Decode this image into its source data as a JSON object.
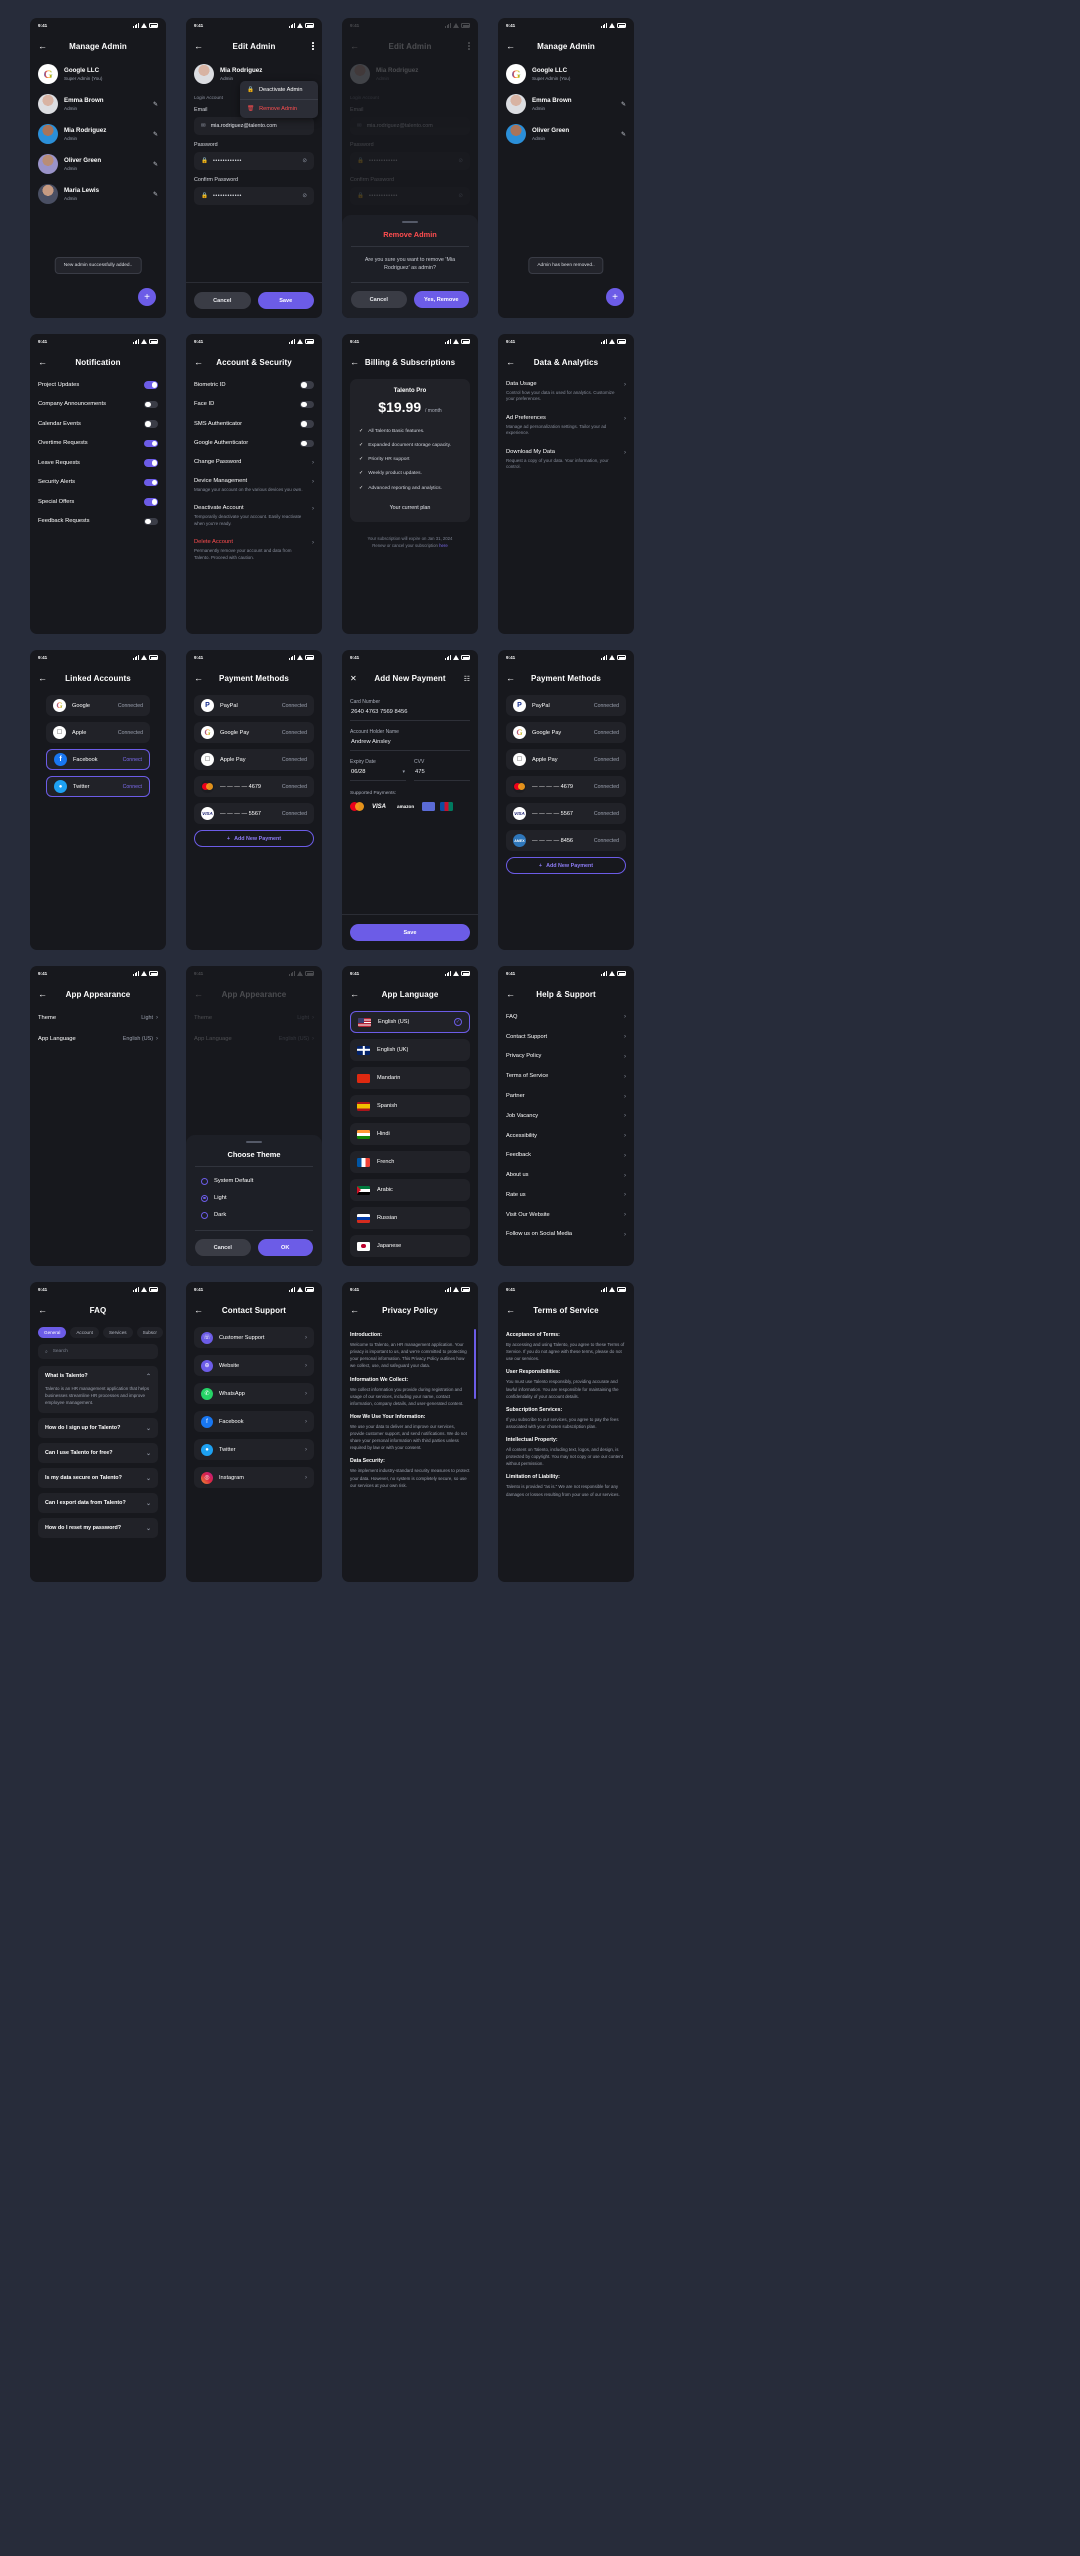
{
  "status_bar": {
    "time": "9:41"
  },
  "screens": {
    "manage_admin": {
      "title": "Manage Admin",
      "toast": "New admin successfully added..",
      "fab": "+",
      "admins": [
        {
          "name": "Google LLC",
          "role": "Super Admin (You)",
          "editable": false
        },
        {
          "name": "Emma Brown",
          "role": "Admin",
          "editable": true
        },
        {
          "name": "Mia Rodriguez",
          "role": "Admin",
          "editable": true
        },
        {
          "name": "Oliver Green",
          "role": "Admin",
          "editable": true
        },
        {
          "name": "Maria Lewis",
          "role": "Admin",
          "editable": true
        }
      ]
    },
    "manage_admin_after": {
      "title": "Manage Admin",
      "toast": "Admin has been removed..",
      "admins": [
        {
          "name": "Google LLC",
          "role": "Super Admin (You)",
          "editable": false
        },
        {
          "name": "Emma Brown",
          "role": "Admin",
          "editable": true
        },
        {
          "name": "Oliver Green",
          "role": "Admin",
          "editable": true
        }
      ]
    },
    "edit_admin": {
      "title": "Edit Admin",
      "user_name": "Mia Rodriguez",
      "user_role": "Admin",
      "section_label": "Login Account",
      "menu": [
        {
          "label": "Deactivate Admin",
          "icon": "lock-icon",
          "danger": false
        },
        {
          "label": "Remove Admin",
          "icon": "trash-icon",
          "danger": true
        }
      ],
      "email_label": "Email",
      "email_value": "mia.rodriguez@talento.com",
      "password_label": "Password",
      "password_value": "••••••••••••",
      "confirm_label": "Confirm Password",
      "confirm_value": "••••••••••••",
      "cancel": "Cancel",
      "save": "Save"
    },
    "remove_admin_dialog": {
      "title": "Remove Admin",
      "message": "Are you sure you want to remove 'Mia Rodriguez' as admin?",
      "cancel": "Cancel",
      "confirm": "Yes, Remove"
    },
    "notification": {
      "title": "Notification",
      "items": [
        {
          "label": "Project Updates",
          "on": true
        },
        {
          "label": "Company Announcements",
          "on": false
        },
        {
          "label": "Calendar Events",
          "on": false
        },
        {
          "label": "Overtime Requests",
          "on": true
        },
        {
          "label": "Leave Requests",
          "on": true
        },
        {
          "label": "Security Alerts",
          "on": true
        },
        {
          "label": "Special Offers",
          "on": true
        },
        {
          "label": "Feedback Requests",
          "on": false
        }
      ]
    },
    "account_security": {
      "title": "Account & Security",
      "toggles": [
        {
          "label": "Biometric ID",
          "on": false
        },
        {
          "label": "Face ID",
          "on": false
        },
        {
          "label": "SMS Authenticator",
          "on": false
        },
        {
          "label": "Google Authenticator",
          "on": false
        }
      ],
      "links": [
        {
          "title": "Change Password",
          "desc": ""
        },
        {
          "title": "Device Management",
          "desc": "Manage your account on the various devices you own."
        },
        {
          "title": "Deactivate Account",
          "desc": "Temporarily deactivate your account. Easily reactivate when you're ready."
        },
        {
          "title": "Delete Account",
          "desc": "Permanently remove your account and data from Talento. Proceed with caution.",
          "danger": true
        }
      ]
    },
    "billing": {
      "title": "Billing & Subscriptions",
      "plan_name": "Talento Pro",
      "price": "$19.99",
      "period": "/ month",
      "features": [
        "All Talento Basic features.",
        "Expanded document storage capacity.",
        "Priority HR support",
        "Weekly product updates.",
        "Advanced reporting and analytics."
      ],
      "current_plan": "Your current plan",
      "note_a": "Your subscription will expire on Jan 31, 2024",
      "note_b": "Renew or cancel your subscription ",
      "note_link": "here"
    },
    "data_analytics": {
      "title": "Data & Analytics",
      "items": [
        {
          "title": "Data Usage",
          "desc": "Control how your data is used for analytics. Customize your preferences."
        },
        {
          "title": "Ad Preferences",
          "desc": "Manage ad personalization settings. Tailor your ad experience."
        },
        {
          "title": "Download My Data",
          "desc": "Request a copy of your data. Your information, your control."
        }
      ]
    },
    "linked_accounts": {
      "title": "Linked Accounts",
      "items": [
        {
          "name": "Google",
          "state": "Connected",
          "connected": true,
          "brand": "google-icon"
        },
        {
          "name": "Apple",
          "state": "Connected",
          "connected": true,
          "brand": "apple-icon"
        },
        {
          "name": "Facebook",
          "state": "Connect",
          "connected": false,
          "brand": "facebook-icon"
        },
        {
          "name": "Twitter",
          "state": "Connect",
          "connected": false,
          "brand": "twitter-icon"
        }
      ]
    },
    "payment_methods": {
      "title": "Payment Methods",
      "add_label": "Add New Payment",
      "items": [
        {
          "name": "PayPal",
          "state": "Connected",
          "brand": "paypal-icon"
        },
        {
          "name": "Google Pay",
          "state": "Connected",
          "brand": "gpay-icon"
        },
        {
          "name": "Apple Pay",
          "state": "Connected",
          "brand": "applepay-icon"
        },
        {
          "name": "—  —  —  —  4679",
          "state": "Connected",
          "brand": "mastercard-icon"
        },
        {
          "name": "—  —  —  —  5567",
          "state": "Connected",
          "brand": "visa-icon"
        }
      ]
    },
    "payment_methods_after": {
      "title": "Payment Methods",
      "add_label": "Add New Payment",
      "items": [
        {
          "name": "PayPal",
          "state": "Connected",
          "brand": "paypal-icon"
        },
        {
          "name": "Google Pay",
          "state": "Connected",
          "brand": "gpay-icon"
        },
        {
          "name": "Apple Pay",
          "state": "Connected",
          "brand": "applepay-icon"
        },
        {
          "name": "—  —  —  —  4679",
          "state": "Connected",
          "brand": "mastercard-icon"
        },
        {
          "name": "—  —  —  —  5567",
          "state": "Connected",
          "brand": "visa-icon"
        },
        {
          "name": "—  —  —  —  8456",
          "state": "Connected",
          "brand": "amex-icon"
        }
      ]
    },
    "add_payment": {
      "title": "Add New Payment",
      "card_label": "Card Number",
      "card_value": "2640 4763 7569 8456",
      "holder_label": "Account Holder Name",
      "holder_value": "Andrew Ainsley",
      "expiry_label": "Expiry Date",
      "expiry_value": "06/28",
      "cvv_label": "CVV",
      "cvv_value": "475",
      "supported_label": "Supported Payments:",
      "logos": [
        "mastercard",
        "VISA",
        "amazon",
        "stripe",
        "JCB"
      ],
      "save": "Save"
    },
    "app_appearance": {
      "title": "App Appearance",
      "theme_label": "Theme",
      "theme_value": "Light",
      "language_label": "App Language",
      "language_value": "English (US)"
    },
    "choose_theme": {
      "title": "Choose Theme",
      "options": [
        {
          "label": "System Default",
          "selected": false
        },
        {
          "label": "Light",
          "selected": true
        },
        {
          "label": "Dark",
          "selected": false
        }
      ],
      "cancel": "Cancel",
      "ok": "OK"
    },
    "app_language": {
      "title": "App Language",
      "items": [
        {
          "label": "English (US)",
          "flag": "f-us",
          "selected": true
        },
        {
          "label": "English (UK)",
          "flag": "f-uk",
          "selected": false
        },
        {
          "label": "Mandarin",
          "flag": "f-cn",
          "selected": false
        },
        {
          "label": "Spanish",
          "flag": "f-es",
          "selected": false
        },
        {
          "label": "Hindi",
          "flag": "f-in",
          "selected": false
        },
        {
          "label": "French",
          "flag": "f-fr",
          "selected": false
        },
        {
          "label": "Arabic",
          "flag": "f-ar",
          "selected": false
        },
        {
          "label": "Russian",
          "flag": "f-ru",
          "selected": false
        },
        {
          "label": "Japanese",
          "flag": "f-jp",
          "selected": false
        }
      ]
    },
    "help_support": {
      "title": "Help & Support",
      "items": [
        "FAQ",
        "Contact Support",
        "Privacy Policy",
        "Terms of Service",
        "Partner",
        "Job Vacancy",
        "Accessibility",
        "Feedback",
        "About us",
        "Rate us",
        "Visit Our Website",
        "Follow us on Social Media"
      ]
    },
    "faq": {
      "title": "FAQ",
      "chips": [
        "General",
        "Account",
        "Services",
        "Subscr"
      ],
      "search_placeholder": "Search",
      "items": [
        {
          "q": "What is Talento?",
          "a": "Talento is an HR management application that helps businesses streamline HR processes and improve employee management.",
          "open": true
        },
        {
          "q": "How do I sign up for Talento?",
          "a": "",
          "open": false
        },
        {
          "q": "Can I use Talento for free?",
          "a": "",
          "open": false
        },
        {
          "q": "Is my data secure on Talento?",
          "a": "",
          "open": false
        },
        {
          "q": "Can I export data from Talento?",
          "a": "",
          "open": false
        },
        {
          "q": "How do I reset my password?",
          "a": "",
          "open": false
        }
      ]
    },
    "contact_support": {
      "title": "Contact Support",
      "items": [
        {
          "label": "Customer Support",
          "icon": "headset-icon"
        },
        {
          "label": "Website",
          "icon": "globe-icon"
        },
        {
          "label": "WhatsApp",
          "icon": "whatsapp-icon"
        },
        {
          "label": "Facebook",
          "icon": "facebook-icon"
        },
        {
          "label": "Twitter",
          "icon": "twitter-icon"
        },
        {
          "label": "Instagram",
          "icon": "instagram-icon"
        }
      ]
    },
    "privacy_policy": {
      "title": "Privacy Policy",
      "sections": [
        {
          "h": "Introduction:",
          "p": "Welcome to Talento, an HR management application. Your privacy is important to us, and we're committed to protecting your personal information. This Privacy Policy outlines how we collect, use, and safeguard your data."
        },
        {
          "h": "Information We Collect:",
          "p": "We collect information you provide during registration and usage of our services, including your name, contact information, company details, and user-generated content."
        },
        {
          "h": "How We Use Your Information:",
          "p": "We use your data to deliver and improve our services, provide customer support, and send notifications. We do not share your personal information with third parties unless required by law or with your consent."
        },
        {
          "h": "Data Security:",
          "p": "We implement industry-standard security measures to protect your data. However, no system is completely secure, so use our services at your own risk."
        }
      ]
    },
    "terms_of_service": {
      "title": "Terms of Service",
      "sections": [
        {
          "h": "Acceptance of Terms:",
          "p": "By accessing and using Talento, you agree to these Terms of Service. If you do not agree with these terms, please do not use our services."
        },
        {
          "h": "User Responsibilities:",
          "p": "You must use Talento responsibly, providing accurate and lawful information. You are responsible for maintaining the confidentiality of your account details."
        },
        {
          "h": "Subscription Services:",
          "p": "If you subscribe to our services, you agree to pay the fees associated with your chosen subscription plan."
        },
        {
          "h": "Intellectual Property:",
          "p": "All content on Talento, including text, logos, and design, is protected by copyright. You may not copy or use our content without permission."
        },
        {
          "h": "Limitation of Liability:",
          "p": "Talento is provided \"as is.\" We are not responsible for any damages or losses resulting from your use of our services."
        }
      ]
    }
  },
  "colors": {
    "accent": "#6c5ce7",
    "danger": "#ff4d4f",
    "bg": "#17181d",
    "board": "#272c3a"
  }
}
